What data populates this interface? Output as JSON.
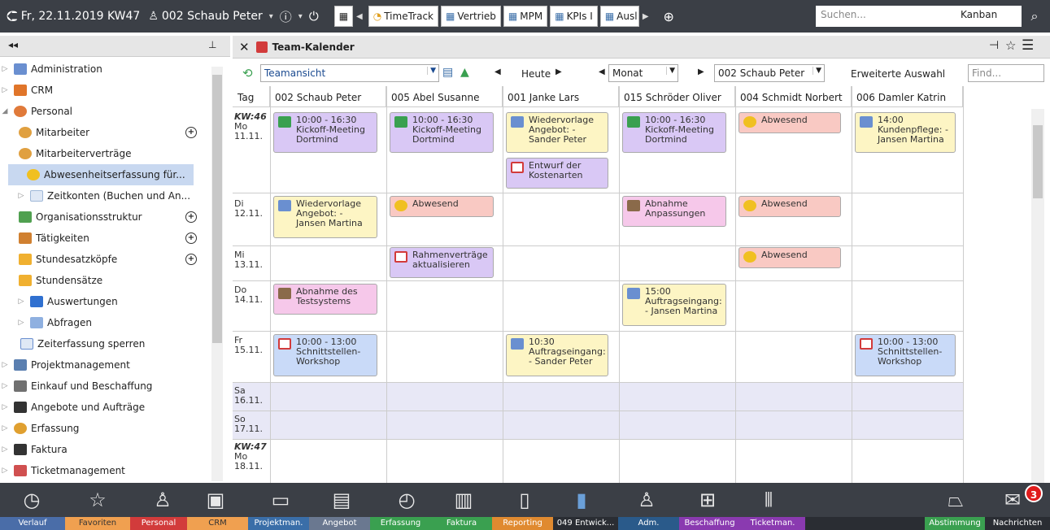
{
  "topbar": {
    "datetext": "Fr, 22.11.2019 KW47",
    "user": "002 Schaub Peter",
    "tabs": [
      "TimeTrack",
      "Vertrieb",
      "MPM",
      "KPIs I",
      "Ausl"
    ],
    "search_placeholder": "Suchen...",
    "search_scope": "Kanban"
  },
  "sidebar": {
    "items": [
      {
        "label": "Administration",
        "color": "#6a8fd0"
      },
      {
        "label": "CRM",
        "color": "#e0752a"
      },
      {
        "label": "Personal",
        "color": "#e07a3a"
      },
      {
        "label": "Mitarbeiter",
        "color": "#e0a040"
      },
      {
        "label": "Mitarbeiterverträge",
        "color": "#e0a040"
      },
      {
        "label": "Abwesenheitserfassung für...",
        "color": "#f0c020"
      },
      {
        "label": "Zeitkonten (Buchen und An...",
        "color": "#dfe8f5"
      },
      {
        "label": "Organisationsstruktur",
        "color": "#50a050"
      },
      {
        "label": "Tätigkeiten",
        "color": "#d08030"
      },
      {
        "label": "Stundesatzköpfe",
        "color": "#f0b030"
      },
      {
        "label": "Stundensätze",
        "color": "#f0b030"
      },
      {
        "label": "Auswertungen",
        "color": "#3070d0"
      },
      {
        "label": "Abfragen",
        "color": "#8fb0e0"
      },
      {
        "label": "Zeiterfassung sperren",
        "color": "#dfe8f5"
      },
      {
        "label": "Projektmanagement",
        "color": "#5a7fb0"
      },
      {
        "label": "Einkauf und Beschaffung",
        "color": "#707070"
      },
      {
        "label": "Angebote und Aufträge",
        "color": "#333333"
      },
      {
        "label": "Erfassung",
        "color": "#e0a030"
      },
      {
        "label": "Faktura",
        "color": "#333333"
      },
      {
        "label": "Ticketmanagement",
        "color": "#d05050"
      }
    ]
  },
  "main": {
    "title": "Team-Kalender",
    "view": "Teamansicht",
    "today": "Heute",
    "range": "Monat",
    "person": "002 Schaub Peter",
    "advanced": "Erweiterte Auswahl",
    "find_placeholder": "Find...",
    "columns": [
      "Tag",
      "002 Schaub Peter",
      "005 Abel Susanne",
      "001 Janke Lars",
      "015 Schröder Oliver",
      "004 Schmidt Norbert",
      "006 Damler Katrin"
    ],
    "days": [
      {
        "kw": "KW:46",
        "dow": "Mo",
        "date": "11.11."
      },
      {
        "dow": "Di",
        "date": "12.11."
      },
      {
        "dow": "Mi",
        "date": "13.11."
      },
      {
        "dow": "Do",
        "date": "14.11."
      },
      {
        "dow": "Fr",
        "date": "15.11."
      },
      {
        "dow": "Sa",
        "date": "16.11."
      },
      {
        "dow": "So",
        "date": "17.11."
      },
      {
        "kw": "KW:47",
        "dow": "Mo",
        "date": "18.11."
      }
    ],
    "events": [
      {
        "text": "10:00 - 16:30 Kickoff-Meeting Dortmind"
      },
      {
        "text": "10:00 - 16:30 Kickoff-Meeting Dortmind"
      },
      {
        "text": "Wiedervorlage Angebot: - Sander Peter"
      },
      {
        "text": "Entwurf der Kostenarten"
      },
      {
        "text": "10:00 - 16:30 Kickoff-Meeting Dortmind"
      },
      {
        "text": "Abwesend"
      },
      {
        "text": "14:00 Kundenpflege: - Jansen Martina"
      },
      {
        "text": "Wiedervorlage Angebot: - Jansen Martina"
      },
      {
        "text": "Abwesend"
      },
      {
        "text": "Abnahme Anpassungen"
      },
      {
        "text": "Abwesend"
      },
      {
        "text": "Rahmenverträge aktualisieren"
      },
      {
        "text": "Abwesend"
      },
      {
        "text": "Abnahme des Testsystems"
      },
      {
        "text": "15:00 Auftragseingang: - Jansen Martina"
      },
      {
        "text": "10:00 - 13:00 Schnittstellen-Workshop"
      },
      {
        "text": "10:30 Auftragseingang: - Sander Peter"
      },
      {
        "text": "10:00 - 13:00 Schnittstellen-Workshop"
      }
    ]
  },
  "dock": {
    "badge": "3",
    "labels": [
      {
        "text": "Verlauf",
        "color": "#4a6da8"
      },
      {
        "text": "Favoriten",
        "color": "#f0a050"
      },
      {
        "text": "Personal",
        "color": "#d23b3b"
      },
      {
        "text": "CRM",
        "color": "#f0a050"
      },
      {
        "text": "Projektman.",
        "color": "#3a6ea8"
      },
      {
        "text": "Angebot",
        "color": "#6a7890"
      },
      {
        "text": "Erfassung",
        "color": "#3aa050"
      },
      {
        "text": "Faktura",
        "color": "#3aa050"
      },
      {
        "text": "Reporting",
        "color": "#e08a30"
      },
      {
        "text": "049 Entwick...",
        "color": "#2a2d33"
      },
      {
        "text": "Adm.",
        "color": "#2a5a8a"
      },
      {
        "text": "Beschaffung",
        "color": "#8a3ab0"
      },
      {
        "text": "Ticketman.",
        "color": "#8a3ab0"
      },
      {
        "text": "Abstimmung",
        "color": "#3aa050"
      },
      {
        "text": "Nachrichten",
        "color": "#2a2d33"
      }
    ]
  }
}
